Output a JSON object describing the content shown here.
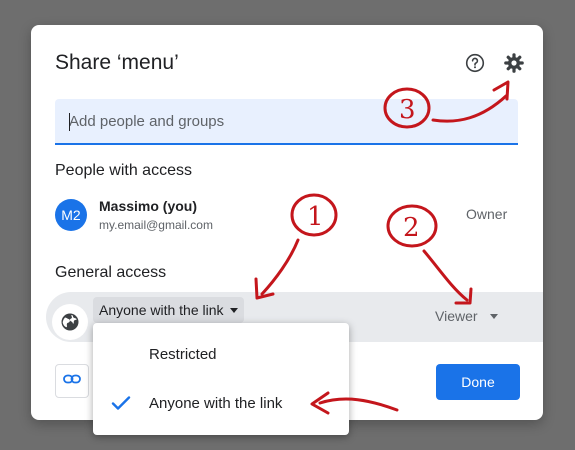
{
  "dialog": {
    "title": "Share ‘menu’",
    "help_icon": "help-circle-icon",
    "settings_icon": "gear-icon"
  },
  "search": {
    "placeholder": "Add people and groups"
  },
  "people": {
    "section_title": "People with access",
    "items": [
      {
        "avatar_text": "M2",
        "name": "Massimo (you)",
        "email": "my.email@gmail.com",
        "role": "Owner"
      }
    ]
  },
  "general_access": {
    "section_title": "General access",
    "selected": "Anyone with the link",
    "role": "Viewer",
    "icon": "globe-icon"
  },
  "menu": {
    "options": [
      {
        "label": "Restricted",
        "checked": false
      },
      {
        "label": "Anyone with the link",
        "checked": true
      }
    ]
  },
  "footer": {
    "copy_link_icon": "link-icon",
    "done_label": "Done"
  },
  "annotations": {
    "labels": [
      "1",
      "2",
      "3"
    ]
  },
  "colors": {
    "accent": "#1a73e8",
    "annotation": "#c4161c",
    "backdrop": "#6e6e6e"
  }
}
